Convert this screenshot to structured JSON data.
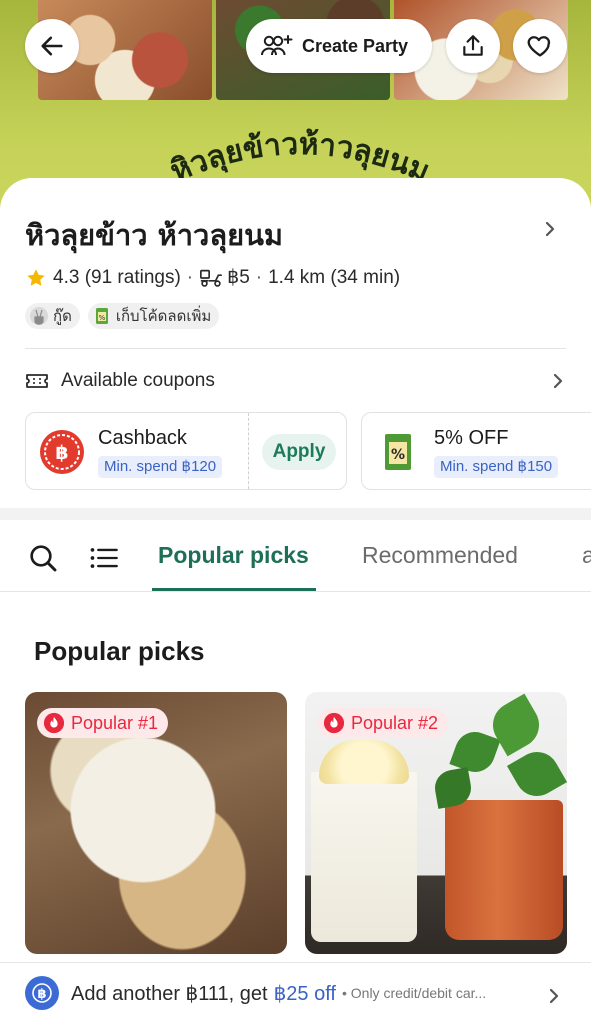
{
  "hero": {
    "brand_text": "หิวลุยข้าวห้าวลุยนม",
    "create_party_label": "Create Party"
  },
  "restaurant": {
    "name": "หิวลุยข้าว ห้าวลุยนม",
    "rating": "4.3 (91 ratings)",
    "delivery_fee": "฿5",
    "distance": "1.4 km (34 min)",
    "tags": [
      {
        "label": "กู๊ด",
        "icon": "peace-hand-icon"
      },
      {
        "label": "เก็บโค้ดลดเพิ่ม",
        "icon": "coupon-ticket-icon"
      }
    ]
  },
  "coupons": {
    "header": "Available coupons",
    "items": [
      {
        "title": "Cashback",
        "min_spend": "Min. spend ฿120",
        "action": "Apply",
        "icon": "cashback-coin-icon"
      },
      {
        "title": "5% OFF",
        "min_spend": "Min. spend ฿150",
        "icon": "discount-receipt-icon"
      }
    ]
  },
  "tabs": {
    "items": [
      "Popular picks",
      "Recommended",
      "a"
    ],
    "active": "Popular picks"
  },
  "popular": {
    "section_title": "Popular picks",
    "items": [
      {
        "badge": "Popular #1"
      },
      {
        "badge": "Popular #2"
      }
    ]
  },
  "promo_bar": {
    "text": "Add another ฿111, get",
    "highlight": "฿25 off",
    "note": "• Only credit/debit car..."
  },
  "colors": {
    "brand_green": "#1e6f57",
    "popular_red": "#e8283f",
    "promo_blue": "#3b62c4",
    "star": "#f5b800"
  }
}
